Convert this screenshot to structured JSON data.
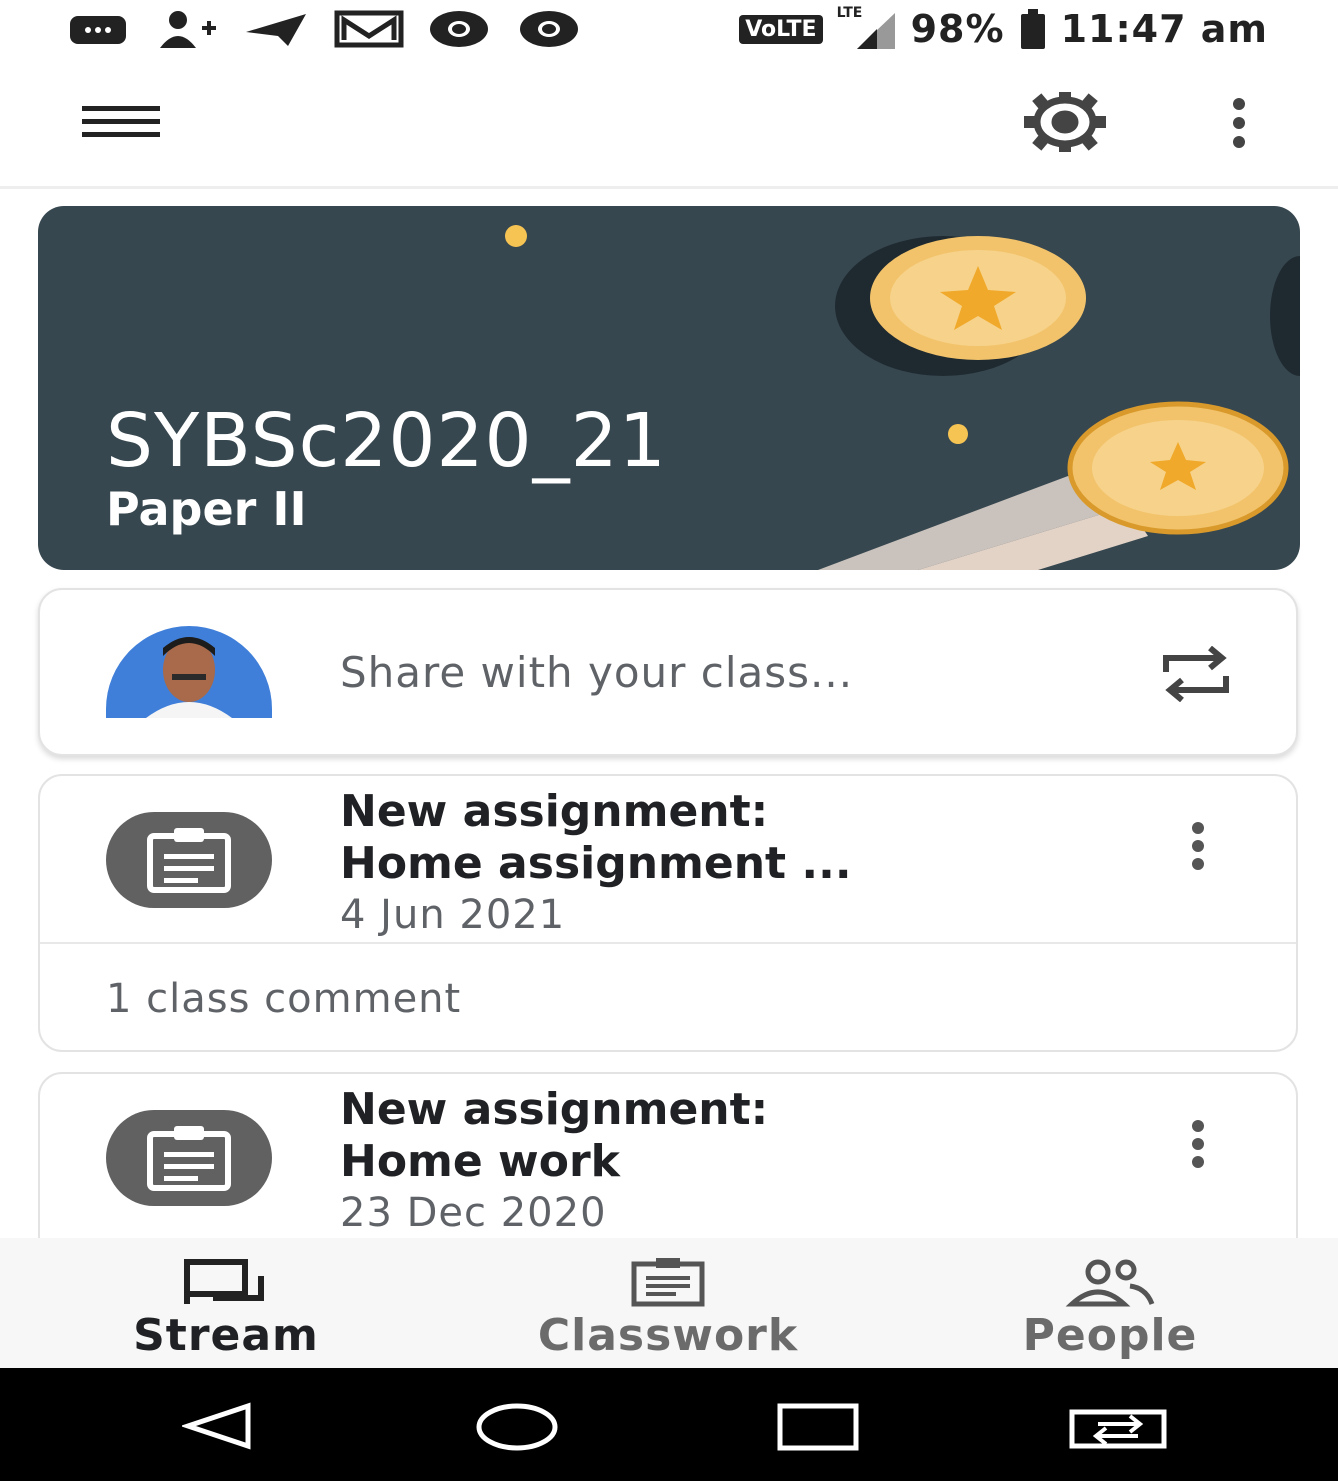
{
  "status_bar": {
    "icons": [
      "message-icon",
      "contact-add-icon",
      "telegram-icon",
      "gmail-icon",
      "chrome-icon",
      "chrome-icon"
    ],
    "network": "VoLTE",
    "signal_label": "LTE",
    "battery": "98%",
    "time": "11:47 am"
  },
  "app_bar": {
    "icons": [
      "menu-icon",
      "settings-icon",
      "more-vert-icon"
    ]
  },
  "banner": {
    "class_name": "SYBSc2020_21",
    "section": "Paper II",
    "color": "#37474f"
  },
  "share": {
    "placeholder": "Share with your class..."
  },
  "posts": [
    {
      "title_line1": "New assignment:",
      "title_line2": "Home assignment ...",
      "date": "4 Jun 2021",
      "comments": "1 class comment"
    },
    {
      "title_line1": "New assignment:",
      "title_line2": "Home work",
      "date": "23 Dec 2020"
    }
  ],
  "bottom_nav": {
    "items": [
      {
        "label": "Stream",
        "icon": "stream-icon",
        "active": true
      },
      {
        "label": "Classwork",
        "icon": "classwork-icon",
        "active": false
      },
      {
        "label": "People",
        "icon": "people-icon",
        "active": false
      }
    ]
  },
  "system_nav": {
    "icons": [
      "back-icon",
      "home-icon",
      "recents-icon",
      "screen-switch-icon"
    ]
  }
}
